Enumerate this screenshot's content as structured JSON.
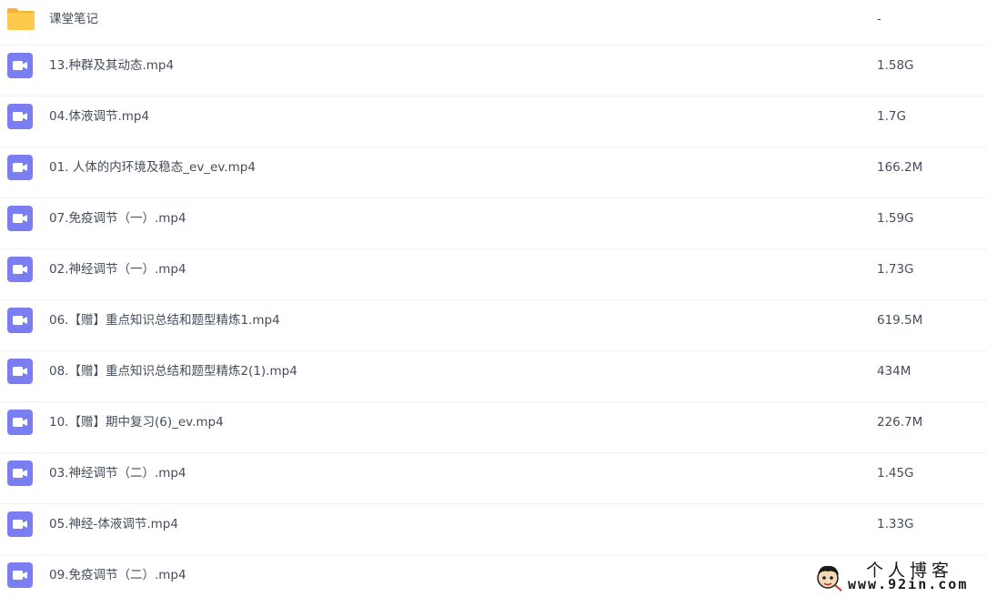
{
  "colors": {
    "folder": "#ffc94d",
    "folder_back": "#f5b335",
    "video": "#7b7ef0",
    "text": "#454d5a",
    "divider": "#f1f2f4"
  },
  "files": [
    {
      "type": "folder",
      "icon": "folder-icon",
      "name": "课堂笔记",
      "size": "-"
    },
    {
      "type": "video",
      "icon": "video-file-icon",
      "name": "13.种群及其动态.mp4",
      "size": "1.58G"
    },
    {
      "type": "video",
      "icon": "video-file-icon",
      "name": "04.体液调节.mp4",
      "size": "1.7G"
    },
    {
      "type": "video",
      "icon": "video-file-icon",
      "name": "01. 人体的内环境及稳态_ev_ev.mp4",
      "size": "166.2M"
    },
    {
      "type": "video",
      "icon": "video-file-icon",
      "name": "07.免疫调节（一）.mp4",
      "size": "1.59G"
    },
    {
      "type": "video",
      "icon": "video-file-icon",
      "name": "02.神经调节（一）.mp4",
      "size": "1.73G"
    },
    {
      "type": "video",
      "icon": "video-file-icon",
      "name": "06.【赠】重点知识总结和题型精炼1.mp4",
      "size": "619.5M"
    },
    {
      "type": "video",
      "icon": "video-file-icon",
      "name": "08.【赠】重点知识总结和题型精炼2(1).mp4",
      "size": "434M"
    },
    {
      "type": "video",
      "icon": "video-file-icon",
      "name": "10.【赠】期中复习(6)_ev.mp4",
      "size": "226.7M"
    },
    {
      "type": "video",
      "icon": "video-file-icon",
      "name": "03.神经调节（二）.mp4",
      "size": "1.45G"
    },
    {
      "type": "video",
      "icon": "video-file-icon",
      "name": "05.神经-体液调节.mp4",
      "size": "1.33G"
    },
    {
      "type": "video",
      "icon": "video-file-icon",
      "name": "09.免疫调节（二）.mp4",
      "size": ""
    }
  ],
  "watermark": {
    "title": "个人博客",
    "url": "www.92in.com",
    "icon": "mascot-logo-icon"
  }
}
